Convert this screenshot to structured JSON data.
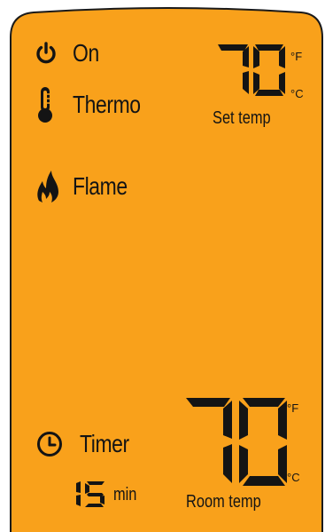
{
  "colors": {
    "panel": "#F9A11B",
    "ink": "#141414",
    "border": "#1a1a1a"
  },
  "indicators": {
    "on": {
      "label": "On",
      "icon": "power-icon"
    },
    "thermo": {
      "label": "Thermo",
      "icon": "thermometer-icon"
    },
    "flame": {
      "label": "Flame",
      "icon": "flame-icon"
    },
    "timer": {
      "label": "Timer",
      "icon": "clock-icon"
    }
  },
  "set_temp": {
    "value": "70",
    "label": "Set temp",
    "unit_f": "°F",
    "unit_c": "°C"
  },
  "room_temp": {
    "value": "70",
    "label": "Room temp",
    "unit_f": "°F",
    "unit_c": "°C"
  },
  "timer": {
    "value": "15",
    "unit": "min"
  }
}
